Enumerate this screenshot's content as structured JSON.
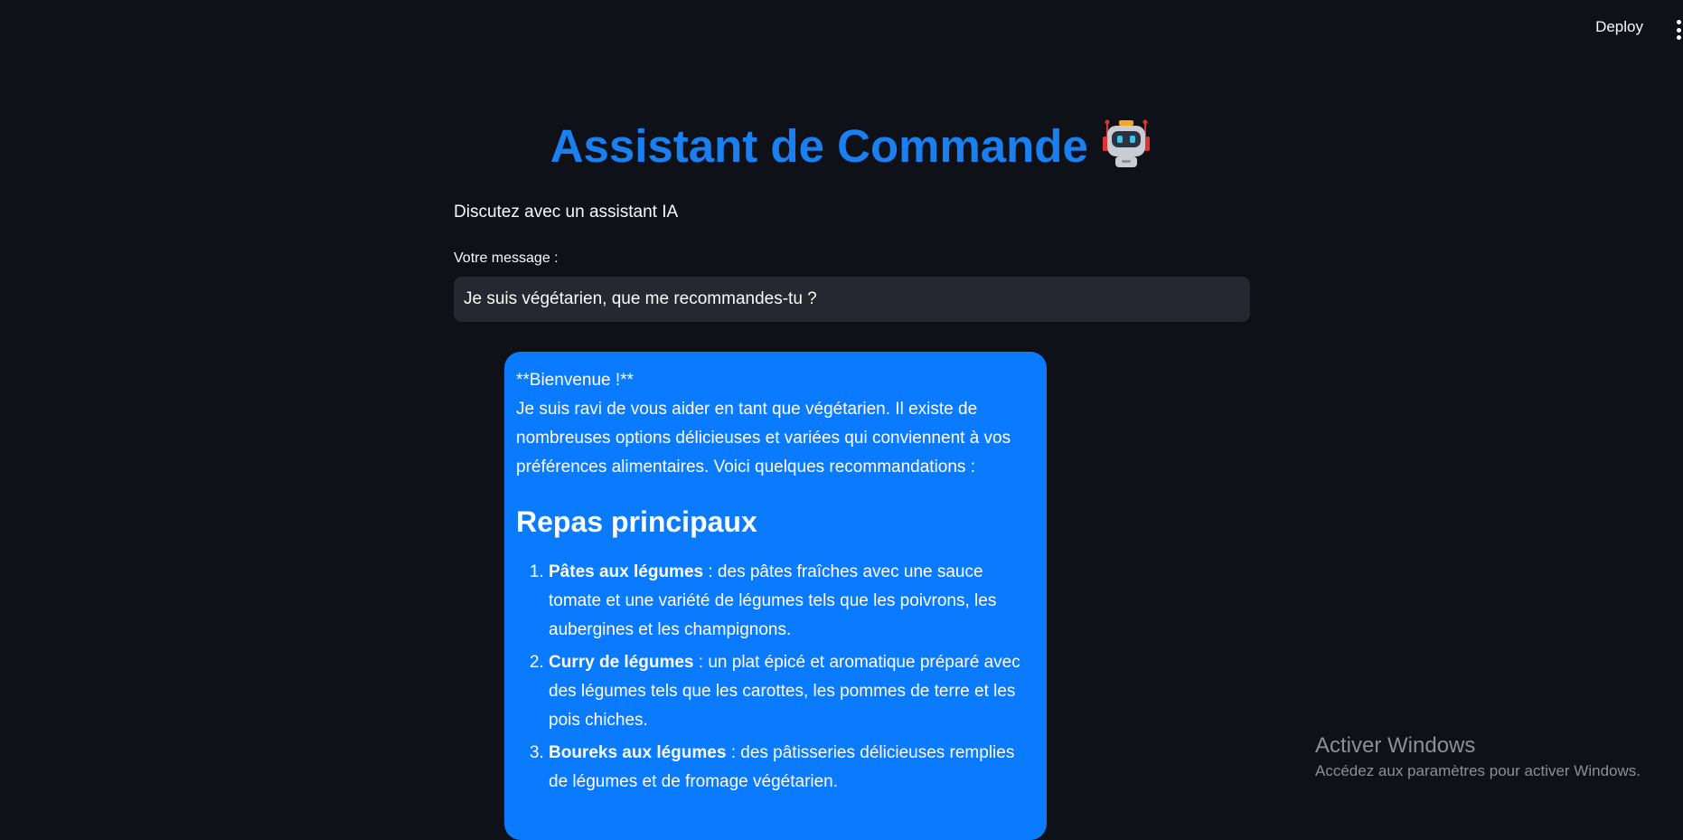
{
  "header": {
    "deploy_label": "Deploy",
    "menu_icon": "kebab-menu-icon"
  },
  "main": {
    "title": "Assistant de Commande",
    "title_icon": "robot-emoji-icon",
    "subtitle": "Discutez avec un assistant IA",
    "input_label": "Votre message :",
    "input_value": "Je suis végétarien, que me recommandes-tu ?"
  },
  "response": {
    "greeting": "**Bienvenue !**",
    "intro": "Je suis ravi de vous aider en tant que végétarien. Il existe de nombreuses options délicieuses et variées qui conviennent à vos préférences alimentaires. Voici quelques recommandations :",
    "section_title": "Repas principaux",
    "items": [
      {
        "name": "Pâtes aux légumes",
        "desc": " : des pâtes fraîches avec une sauce tomate et une variété de légumes tels que les poivrons, les aubergines et les champignons."
      },
      {
        "name": "Curry de légumes",
        "desc": " : un plat épicé et aromatique préparé avec des légumes tels que les carottes, les pommes de terre et les pois chiches."
      },
      {
        "name": "Boureks aux légumes",
        "desc": " : des pâtisseries délicieuses remplies de légumes et de fromage végétarien."
      }
    ]
  },
  "watermark": {
    "line1": "Activer Windows",
    "line2": "Accédez aux paramètres pour activer Windows."
  },
  "colors": {
    "background": "#0e1117",
    "accent": "#1a7ff0",
    "bubble": "#0a7bff",
    "input_bg": "#262730"
  }
}
